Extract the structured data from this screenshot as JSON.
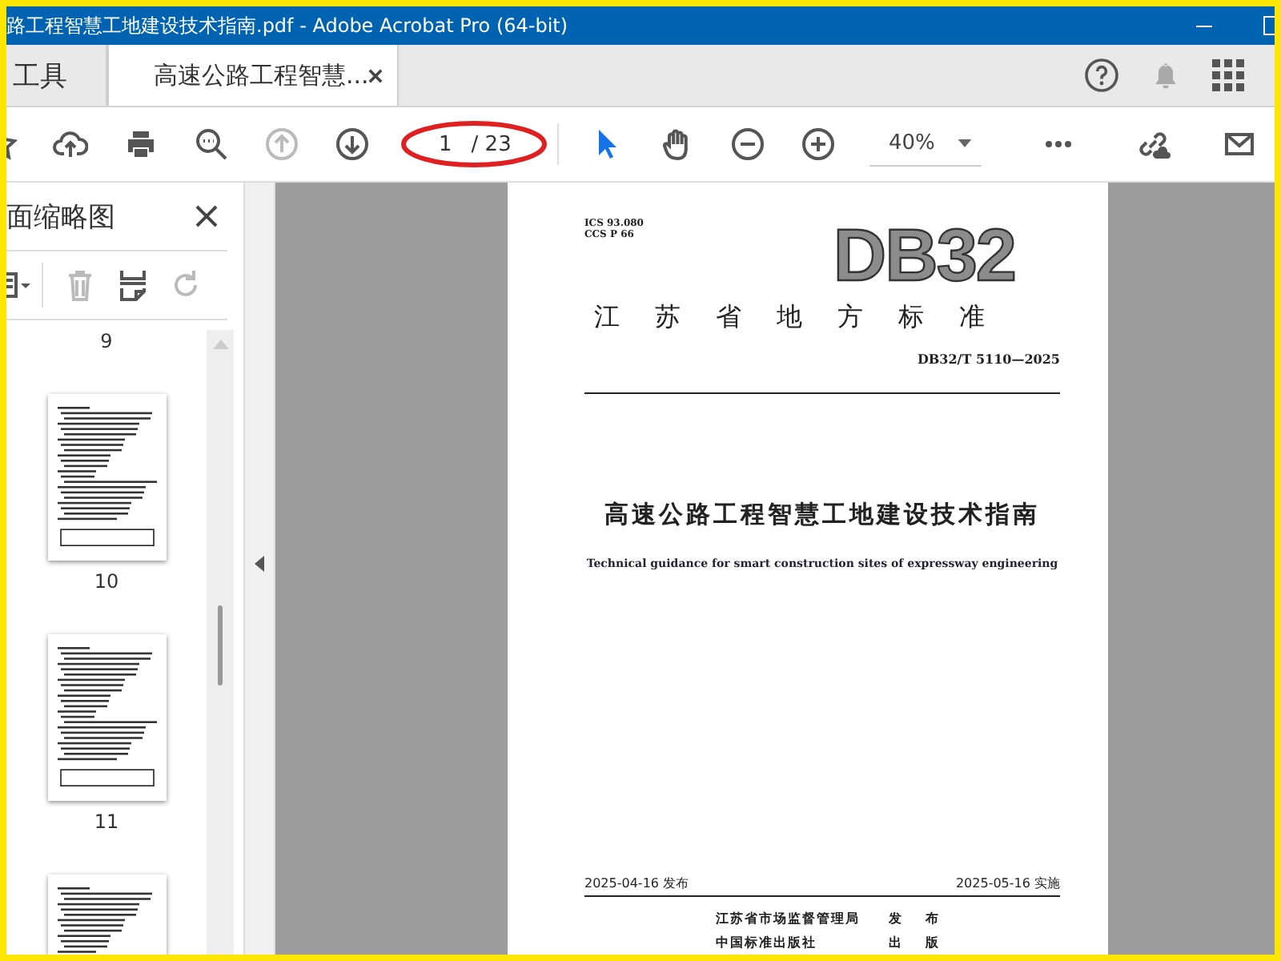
{
  "window": {
    "title": "路工程智慧工地建设技术指南.pdf - Adobe Acrobat Pro (64-bit)"
  },
  "tabs": [
    {
      "label": "工具",
      "selected": false
    },
    {
      "label": "高速公路工程智慧...",
      "selected": true
    }
  ],
  "toolbar": {
    "tools": [
      {
        "kind": "star",
        "disabled": false,
        "selected": false
      },
      {
        "kind": "upload",
        "disabled": false,
        "selected": false
      },
      {
        "kind": "print",
        "disabled": false,
        "selected": false
      },
      {
        "kind": "zoom-search",
        "disabled": false,
        "selected": false
      },
      {
        "kind": "prev-page",
        "disabled": true,
        "selected": false
      },
      {
        "kind": "next-page",
        "disabled": false,
        "selected": false
      },
      {
        "kind": "page-field"
      },
      {
        "kind": "pointer",
        "disabled": false,
        "selected": true
      },
      {
        "kind": "hand",
        "disabled": false,
        "selected": false
      },
      {
        "kind": "zoom-out",
        "disabled": false,
        "selected": false
      },
      {
        "kind": "zoom-in",
        "disabled": false,
        "selected": false
      },
      {
        "kind": "zoom-field"
      },
      {
        "kind": "more",
        "disabled": false,
        "selected": false
      },
      {
        "kind": "spacer"
      },
      {
        "kind": "link-cloud",
        "disabled": false,
        "selected": false
      },
      {
        "kind": "mail",
        "disabled": false,
        "selected": false
      }
    ],
    "page_value": "1",
    "page_total": "/ 23",
    "zoom_value": "40%"
  },
  "panel": {
    "title": "面缩略图",
    "tools": [
      {
        "kind": "options",
        "disabled": false
      },
      {
        "kind": "trash",
        "disabled": true
      },
      {
        "kind": "extract",
        "disabled": false
      },
      {
        "kind": "rotate",
        "disabled": true
      }
    ],
    "page_labels": [
      "9",
      "10",
      "11"
    ]
  },
  "document": {
    "ics": "ICS 93.080",
    "ccs": "CCS P 66",
    "code": "DB32",
    "category": "江苏省地方标准",
    "number": "DB32/T 5110—2025",
    "title": "高速公路工程智慧工地建设技术指南",
    "subtitle": "Technical guidance for smart construction sites of expressway engineering",
    "issue_date": "2025-04-16 发布",
    "effective_date": "2025-05-16 实施",
    "publishers": [
      {
        "name": "江苏省市场监督管理局",
        "role": "发 布"
      },
      {
        "name": "中国标准出版社",
        "role": "出 版"
      }
    ]
  }
}
